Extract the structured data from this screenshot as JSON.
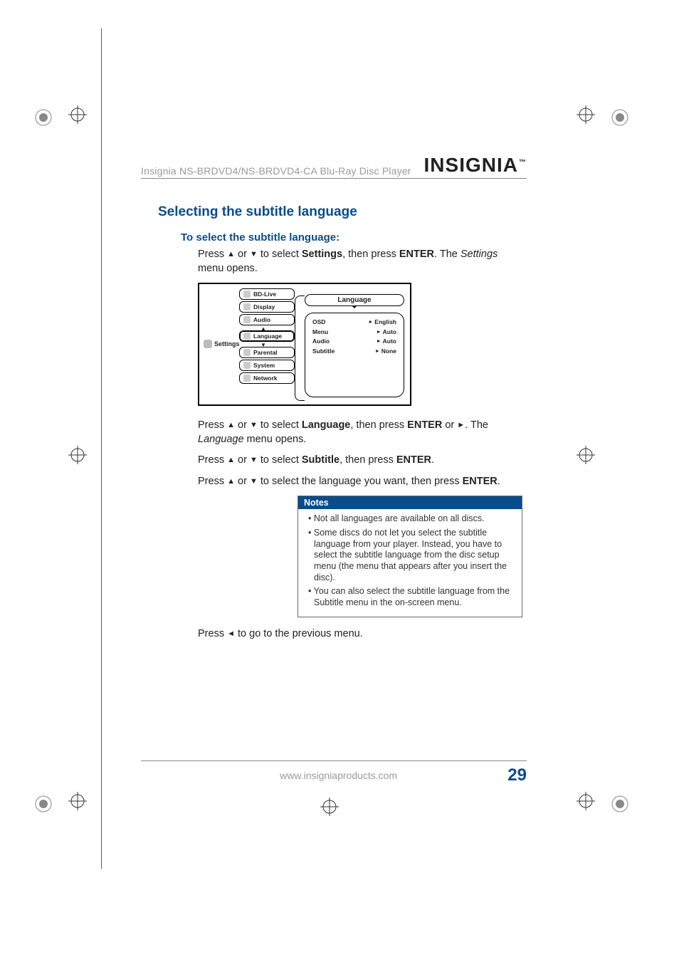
{
  "header": {
    "model_line": "Insignia NS-BRDVD4/NS-BRDVD4-CA Blu-Ray Disc Player",
    "brand": "INSIGNIA"
  },
  "section_title": "Selecting the subtitle language",
  "subheading": "To select the subtitle language:",
  "step1": {
    "pre": "Press ",
    "mid": " or ",
    "post1": " to select ",
    "settings": "Settings",
    "post2": ", then press ",
    "enter": "ENTER",
    "post3": ". The ",
    "menu_name": "Settings",
    "post4": " menu opens."
  },
  "screenshot": {
    "left_label": "Settings",
    "menu": {
      "bdlive": "BD-Live",
      "display": "Display",
      "audio": "Audio",
      "language": "Language",
      "parental": "Parental",
      "system": "System",
      "network": "Network"
    },
    "panel_title": "Language",
    "rows": {
      "osd_k": "OSD",
      "osd_v": "English",
      "menu_k": "Menu",
      "menu_v": "Auto",
      "audio_k": "Audio",
      "audio_v": "Auto",
      "subtitle_k": "Subtitle",
      "subtitle_v": "None"
    }
  },
  "step2": {
    "pre": "Press ",
    "mid": " or ",
    "post1": " to select ",
    "language": "Language",
    "post2": ", then press ",
    "enter": "ENTER",
    "post3": " or ",
    "post4": ". The ",
    "menu_name": "Language",
    "post5": " menu opens."
  },
  "step3": {
    "pre": "Press ",
    "mid": " or ",
    "post1": " to select ",
    "subtitle": "Subtitle",
    "post2": ", then press ",
    "enter": "ENTER",
    "post3": "."
  },
  "step4": {
    "pre": "Press ",
    "mid": " or ",
    "post1": " to select the language you want, then press ",
    "enter": "ENTER",
    "post2": "."
  },
  "notes": {
    "header": "Notes",
    "n1": "Not all languages are available on all discs.",
    "n2": "Some discs do not let you select the subtitle language from your player. Instead, you have to select the subtitle language from the disc setup menu (the menu that appears after you insert the disc).",
    "n3": "You can also select the subtitle language from the Subtitle menu in the on-screen menu."
  },
  "step5": {
    "pre": "Press ",
    "post": " to go to the previous menu."
  },
  "footer": {
    "url": "www.insigniaproducts.com",
    "page": "29"
  }
}
